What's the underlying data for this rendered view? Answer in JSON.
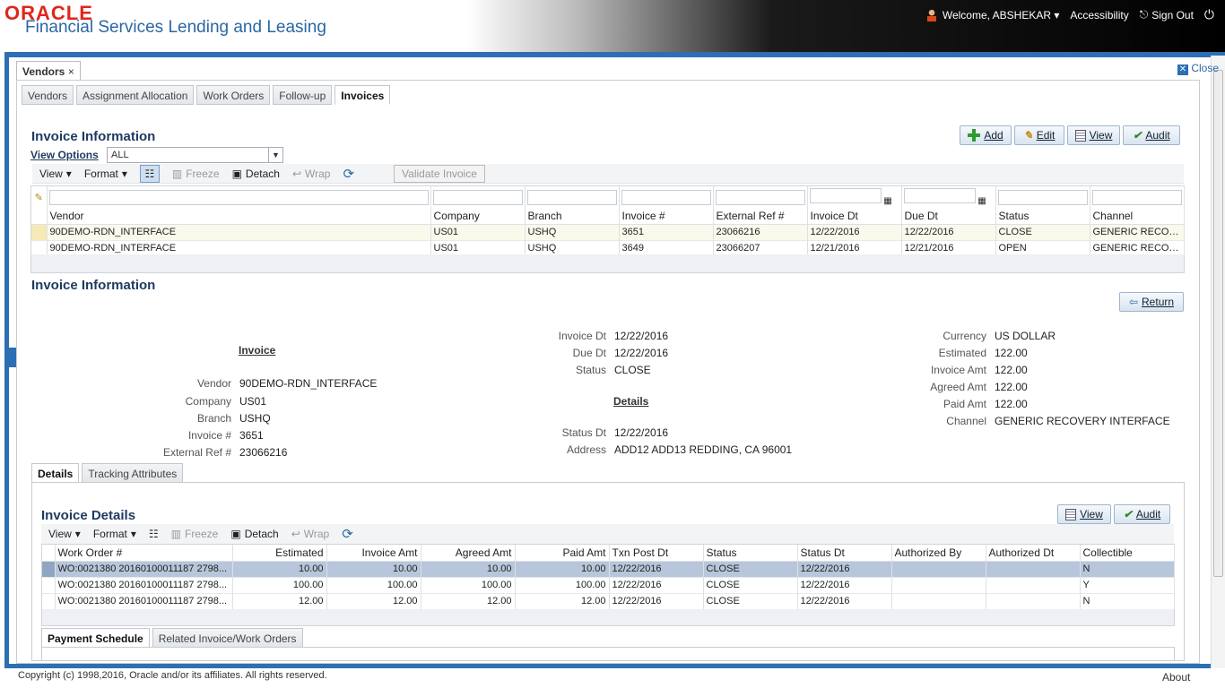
{
  "header": {
    "brand": "ORACLE",
    "product": "Financial Services Lending and Leasing",
    "welcome": "Welcome, ABSHEKAR",
    "accessibility": "Accessibility",
    "signout": "Sign Out"
  },
  "doc_tab": {
    "label": "Vendors",
    "close": "Close"
  },
  "tabs": [
    "Vendors",
    "Assignment Allocation",
    "Work Orders",
    "Follow-up",
    "Invoices"
  ],
  "invoice_section": {
    "title": "Invoice Information",
    "buttons": {
      "add": "Add",
      "edit": "Edit",
      "view": "View",
      "audit": "Audit"
    },
    "view_options_label": "View Options",
    "view_options_value": "ALL",
    "toolbar": {
      "view": "View",
      "format": "Format",
      "freeze": "Freeze",
      "detach": "Detach",
      "wrap": "Wrap",
      "validate": "Validate Invoice"
    },
    "columns": [
      "Vendor",
      "Company",
      "Branch",
      "Invoice #",
      "External Ref #",
      "Invoice Dt",
      "Due Dt",
      "Status",
      "Channel"
    ],
    "rows": [
      [
        "90DEMO-RDN_INTERFACE",
        "US01",
        "USHQ",
        "3651",
        "23066216",
        "12/22/2016",
        "12/22/2016",
        "CLOSE",
        "GENERIC RECOVE..."
      ],
      [
        "90DEMO-RDN_INTERFACE",
        "US01",
        "USHQ",
        "3649",
        "23066207",
        "12/21/2016",
        "12/21/2016",
        "OPEN",
        "GENERIC RECOVE..."
      ]
    ]
  },
  "detail_section": {
    "title": "Invoice Information",
    "return": "Return",
    "invoice_heading": "Invoice",
    "details_heading": "Details",
    "left": [
      [
        "Vendor",
        "90DEMO-RDN_INTERFACE"
      ],
      [
        "Company",
        "US01"
      ],
      [
        "Branch",
        "USHQ"
      ],
      [
        "Invoice #",
        "3651"
      ],
      [
        "External Ref #",
        "23066216"
      ]
    ],
    "middle_top": [
      [
        "Invoice Dt",
        "12/22/2016"
      ],
      [
        "Due Dt",
        "12/22/2016"
      ],
      [
        "Status",
        "CLOSE"
      ]
    ],
    "middle_bottom": [
      [
        "Status Dt",
        "12/22/2016"
      ],
      [
        "Address",
        "ADD12 ADD13 REDDING, CA 96001"
      ]
    ],
    "right": [
      [
        "Currency",
        "US DOLLAR"
      ],
      [
        "Estimated",
        "122.00"
      ],
      [
        "Invoice Amt",
        "122.00"
      ],
      [
        "Agreed Amt",
        "122.00"
      ],
      [
        "Paid Amt",
        "122.00"
      ],
      [
        "Channel",
        "GENERIC RECOVERY INTERFACE"
      ]
    ]
  },
  "lower_tabs": [
    "Details",
    "Tracking Attributes"
  ],
  "invoice_details": {
    "title": "Invoice Details",
    "buttons": {
      "view": "View",
      "audit": "Audit"
    },
    "toolbar": {
      "view": "View",
      "format": "Format",
      "freeze": "Freeze",
      "detach": "Detach",
      "wrap": "Wrap"
    },
    "columns": [
      "Work Order #",
      "Estimated",
      "Invoice Amt",
      "Agreed Amt",
      "Paid Amt",
      "Txn Post Dt",
      "Status",
      "Status Dt",
      "Authorized By",
      "Authorized Dt",
      "Collectible"
    ],
    "rows": [
      [
        "WO:0021380 20160100011187 2798...",
        "10.00",
        "10.00",
        "10.00",
        "10.00",
        "12/22/2016",
        "CLOSE",
        "12/22/2016",
        "",
        "",
        "N"
      ],
      [
        "WO:0021380 20160100011187 2798...",
        "100.00",
        "100.00",
        "100.00",
        "100.00",
        "12/22/2016",
        "CLOSE",
        "12/22/2016",
        "",
        "",
        "Y"
      ],
      [
        "WO:0021380 20160100011187 2798...",
        "12.00",
        "12.00",
        "12.00",
        "12.00",
        "12/22/2016",
        "CLOSE",
        "12/22/2016",
        "",
        "",
        "N"
      ]
    ]
  },
  "bottom_tabs": [
    "Payment Schedule",
    "Related Invoice/Work Orders"
  ],
  "footer": {
    "copyright": "Copyright (c) 1998,2016, Oracle and/or its affiliates. All rights reserved.",
    "about": "About"
  },
  "colors": {
    "brand_red": "#e0261b",
    "frame_blue": "#2d6fb3",
    "title_blue": "#2a67a4"
  }
}
